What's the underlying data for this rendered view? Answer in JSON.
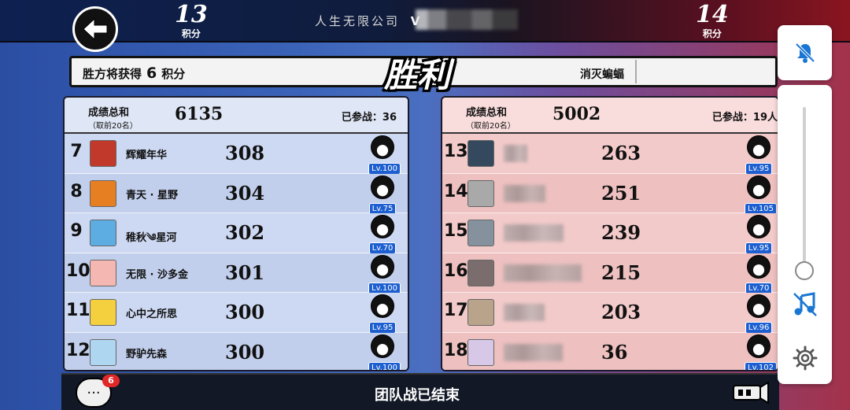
{
  "top": {
    "left_score": "13",
    "right_score": "14",
    "score_unit": "积分",
    "team_label": "人生无限公司",
    "opponent_initial": "V"
  },
  "banner": {
    "reward_prefix": "胜方将获得",
    "reward_points": "6",
    "reward_suffix": "积分",
    "result": "胜利",
    "mode": "消灭蝙蝠"
  },
  "left_team": {
    "title": "成绩总和",
    "subtitle": "（取前20名）",
    "total": "6135",
    "participants": "已参战：36",
    "rows": [
      {
        "rank": "7",
        "name": "辉耀年华",
        "score": "308",
        "level": "Lv.100",
        "avatar_color": "#c0392b"
      },
      {
        "rank": "8",
        "name": "青天 · 星野",
        "score": "304",
        "level": "Lv.75",
        "avatar_color": "#e67e22"
      },
      {
        "rank": "9",
        "name": "稚秋༄星河",
        "score": "302",
        "level": "Lv.70",
        "avatar_color": "#5dade2"
      },
      {
        "rank": "10",
        "name": "无限 · 沙多金",
        "score": "301",
        "level": "Lv.100",
        "avatar_color": "#f5b7b1"
      },
      {
        "rank": "11",
        "name": "心中之所思",
        "score": "300",
        "level": "Lv.95",
        "avatar_color": "#f4d03f"
      },
      {
        "rank": "12",
        "name": "野驴先森",
        "score": "300",
        "level": "Lv.100",
        "avatar_color": "#aed6f1"
      }
    ]
  },
  "right_team": {
    "title": "成绩总和",
    "subtitle": "（取前20名）",
    "total": "5002",
    "participants": "已参战：19人",
    "rows": [
      {
        "rank": "13",
        "score": "263",
        "level": "Lv.95",
        "avatar_color": "#34495e"
      },
      {
        "rank": "14",
        "score": "251",
        "level": "Lv.105",
        "avatar_color": "#a9a9a9"
      },
      {
        "rank": "15",
        "score": "239",
        "level": "Lv.95",
        "avatar_color": "#85929e"
      },
      {
        "rank": "16",
        "score": "215",
        "level": "Lv.70",
        "avatar_color": "#7b6d6d"
      },
      {
        "rank": "17",
        "score": "203",
        "level": "Lv.96",
        "avatar_color": "#b9a38b"
      },
      {
        "rank": "18",
        "score": "36",
        "level": "Lv.102",
        "avatar_color": "#d7c8e8"
      }
    ]
  },
  "bottom": {
    "chat_badge": "6",
    "status": "团队战已结束"
  },
  "side_controls": {
    "volume_level": 0.02
  }
}
